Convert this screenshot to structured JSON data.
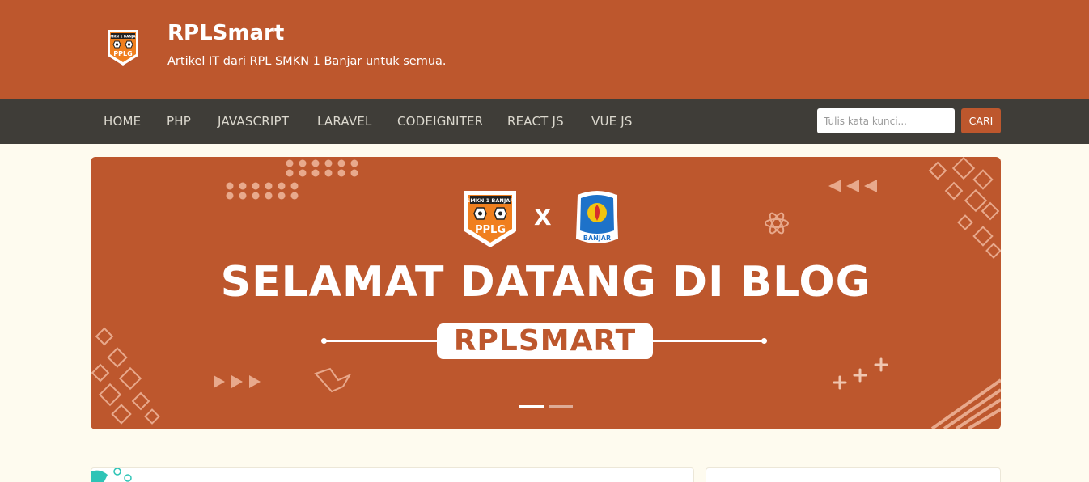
{
  "header": {
    "logo_badge": "SMKN 1 BANJAR",
    "logo_text": "PPLG",
    "title": "RPLSmart",
    "tagline": "Artikel IT dari RPL SMKN 1 Banjar untuk semua."
  },
  "nav": {
    "items": [
      {
        "label": "HOME"
      },
      {
        "label": "PHP"
      },
      {
        "label": "JAVASCRIPT"
      },
      {
        "label": "LARAVEL"
      },
      {
        "label": "CODEIGNITER"
      },
      {
        "label": "REACT JS"
      },
      {
        "label": "VUE JS"
      }
    ],
    "search_placeholder": "Tulis kata kunci...",
    "search_button": "CARI"
  },
  "hero": {
    "logo_left_badge": "SMKN 1 BANJAR",
    "logo_left_text": "PPLG",
    "separator": "X",
    "logo_right_text": "BANJAR",
    "title": "SELAMAT DATANG DI BLOG",
    "pill": "RPLSMART",
    "slides_total": 2,
    "slide_active": 1
  },
  "colors": {
    "brand": "#bd572d",
    "navbar": "#3f3d38",
    "page_bg": "#fefbef"
  }
}
